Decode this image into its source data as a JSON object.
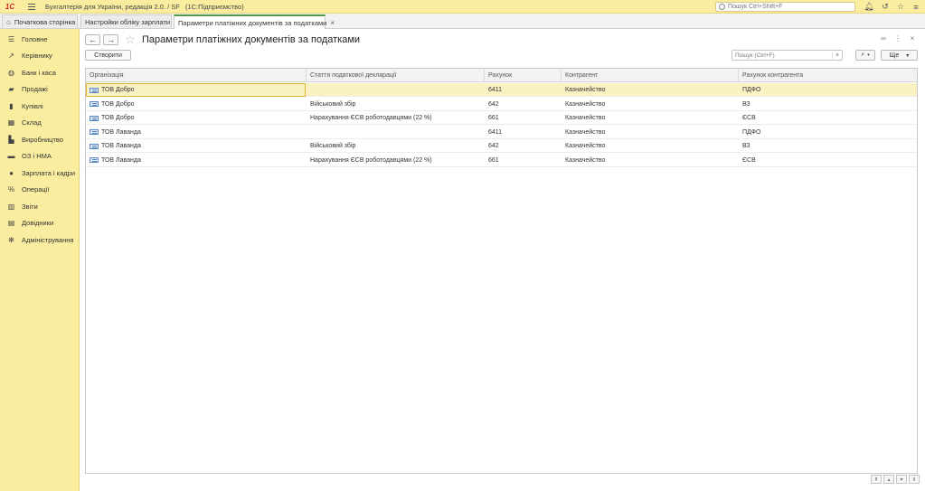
{
  "app": {
    "logo": "1С",
    "title": "Бухгалтерія для України, редакція 2.0. / SF",
    "platform": "(1С:Підприємство)",
    "search_placeholder": "Пошук Ctrl+Shift+F"
  },
  "tabs": [
    {
      "label": "Початкова сторінка",
      "icon": "home-icon"
    },
    {
      "label": "Настройки обліку зарплати"
    },
    {
      "label": "Параметри платіжних документів за податками",
      "active": true
    }
  ],
  "sidebar": {
    "items": [
      {
        "label": "Головне",
        "icon": "menu-lines-icon"
      },
      {
        "label": "Керівнику",
        "icon": "trend-icon"
      },
      {
        "label": "Банк і каса",
        "icon": "bank-icon"
      },
      {
        "label": "Продажі",
        "icon": "bag-icon"
      },
      {
        "label": "Купівлі",
        "icon": "cart-icon"
      },
      {
        "label": "Склад",
        "icon": "warehouse-icon"
      },
      {
        "label": "Виробництво",
        "icon": "factory-icon"
      },
      {
        "label": "ОЗ і НМА",
        "icon": "assets-icon"
      },
      {
        "label": "Зарплата і кадри",
        "icon": "person-icon"
      },
      {
        "label": "Операції",
        "icon": "operations-icon"
      },
      {
        "label": "Звіти",
        "icon": "reports-icon"
      },
      {
        "label": "Довідники",
        "icon": "book-icon"
      },
      {
        "label": "Адміністрування",
        "icon": "gear-icon"
      }
    ]
  },
  "page": {
    "title": "Параметри платіжних документів за податками",
    "create_label": "Створити",
    "search_placeholder": "Пошук (Ctrl+F)",
    "more_label": "Ще"
  },
  "table": {
    "columns": [
      "Організація",
      "Стаття податкової декларації",
      "Рахунок",
      "Контрагент",
      "Рахунок контрагента"
    ],
    "rows": [
      [
        "ТОВ Добро",
        "",
        "6411",
        "Казначейство",
        "ПДФО"
      ],
      [
        "ТОВ Добро",
        "Військовий збір",
        "642",
        "Казначейство",
        "ВЗ"
      ],
      [
        "ТОВ Добро",
        "Нарахування ЄСВ роботодавцями (22 %)",
        "661",
        "Казначейство",
        "ЄСВ"
      ],
      [
        "ТОВ Лаванда",
        "",
        "6411",
        "Казначейство",
        "ПДФО"
      ],
      [
        "ТОВ Лаванда",
        "Військовий збір",
        "642",
        "Казначейство",
        "ВЗ"
      ],
      [
        "ТОВ Лаванда",
        "Нарахування ЄСВ роботодавцями (22 %)",
        "661",
        "Казначейство",
        "ЄСВ"
      ]
    ],
    "selected_row": 0
  },
  "colors": {
    "sidebar_bg": "#fbeda0",
    "selected_row": "#fbf2c4",
    "active_tab_accent": "#4a9a4a"
  }
}
